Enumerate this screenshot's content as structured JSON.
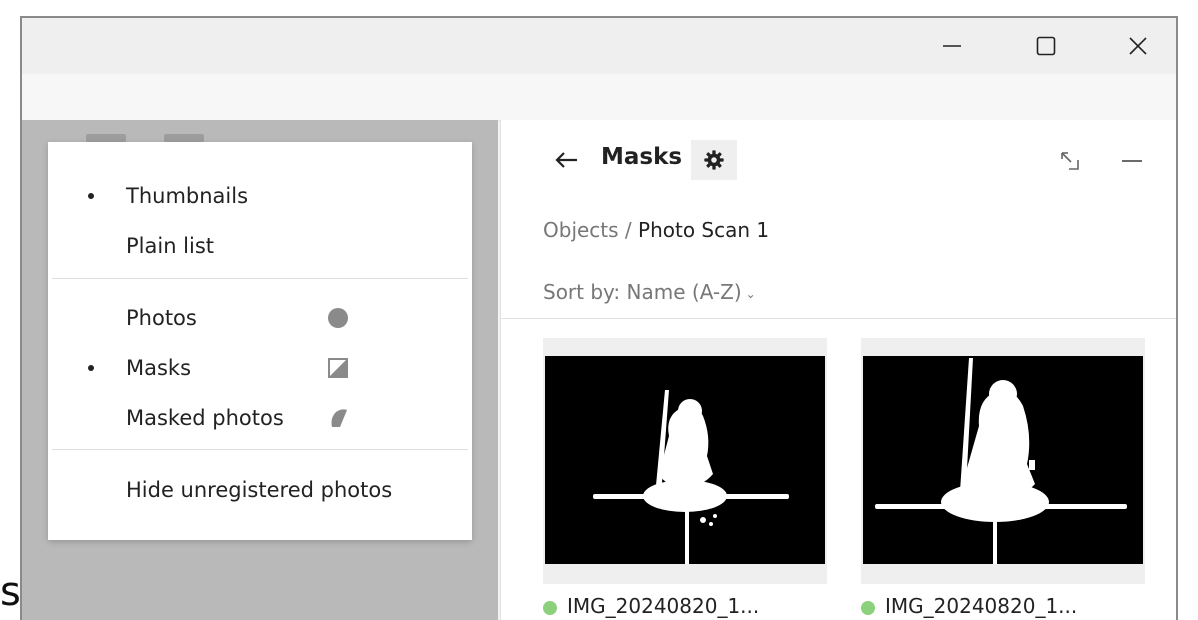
{
  "outside_text": "s",
  "window": {
    "minimize_icon": "minimize-icon",
    "maximize_icon": "maximize-icon",
    "close_icon": "close-icon"
  },
  "view_menu": {
    "items": [
      {
        "label": "Thumbnails",
        "selected": true
      },
      {
        "label": "Plain list",
        "selected": false
      }
    ],
    "layers": [
      {
        "label": "Photos",
        "selected": false,
        "icon": "circle-icon"
      },
      {
        "label": "Masks",
        "selected": true,
        "icon": "mask-icon"
      },
      {
        "label": "Masked photos",
        "selected": false,
        "icon": "masked-photo-icon"
      }
    ],
    "options": [
      {
        "label": "Hide unregistered photos"
      }
    ]
  },
  "panel": {
    "title": "Masks",
    "back_icon": "arrow-left-icon",
    "settings_icon": "gear-icon",
    "breadcrumb": {
      "root": "Objects",
      "separator": " / ",
      "current": "Photo Scan 1"
    },
    "sort_label": "Sort by: Name (A-Z)",
    "thumbnails": [
      {
        "caption": "IMG_20240820_1...",
        "status_color": "#8bd17c"
      },
      {
        "caption": "IMG_20240820_1...",
        "status_color": "#8bd17c"
      }
    ]
  },
  "colors": {
    "menu_bg": "#ffffff",
    "left_pane_bg": "#b9b9b9",
    "thumbnail_bg": "#000000",
    "status_ok": "#8bd17c"
  }
}
